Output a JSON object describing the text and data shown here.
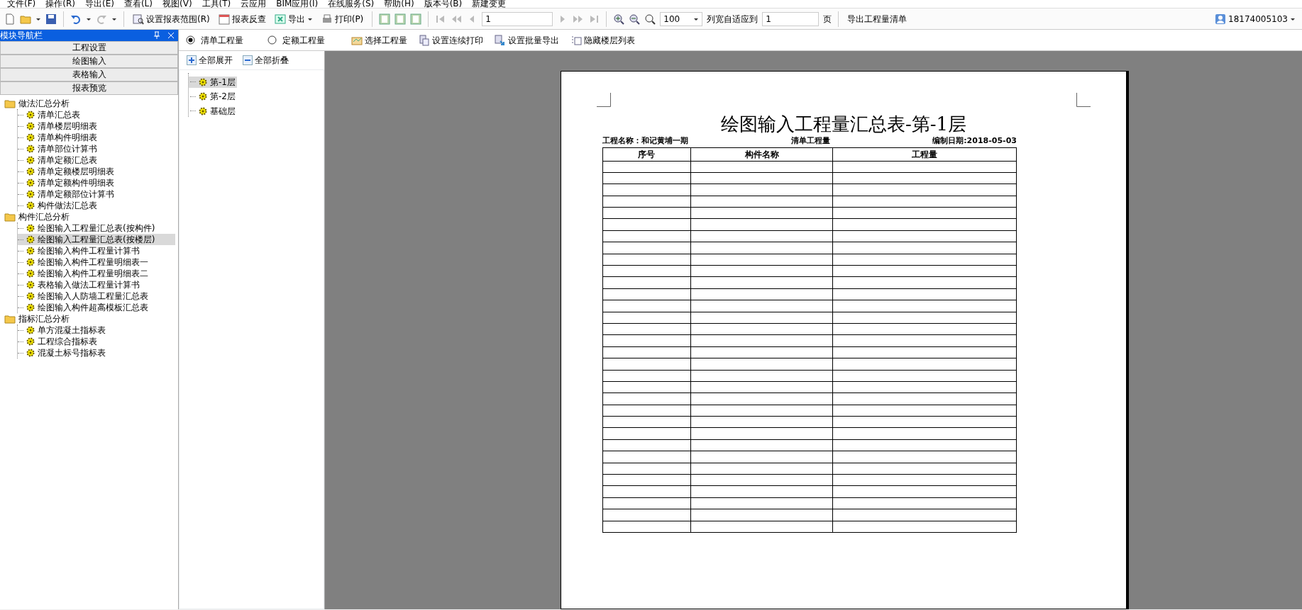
{
  "menu": [
    "文件(F)",
    "操作(R)",
    "导出(E)",
    "查看(L)",
    "视图(V)",
    "工具(T)",
    "云应用",
    "BIM应用(I)",
    "在线服务(S)",
    "帮助(H)",
    "版本号(B)",
    "新建变更"
  ],
  "toolbar": {
    "report_buttons": [
      "设置报表范围(R)",
      "报表反查",
      "导出",
      "打印(P)"
    ],
    "page_field": "1",
    "zoom_value": "100",
    "fit_label": "列宽自适应到",
    "fit_pages": "1",
    "fit_unit": "页",
    "export_list": "导出工程量清单"
  },
  "user": "18174005103",
  "nav": {
    "title": "模块导航栏",
    "sections": [
      "工程设置",
      "绘图输入",
      "表格输入",
      "报表预览"
    ],
    "tree": [
      {
        "label": "做法汇总分析",
        "children": [
          {
            "label": "清单汇总表",
            "selected": false
          },
          {
            "label": "清单楼层明细表",
            "selected": false
          },
          {
            "label": "清单构件明细表",
            "selected": false
          },
          {
            "label": "清单部位计算书",
            "selected": false
          },
          {
            "label": "清单定额汇总表",
            "selected": false
          },
          {
            "label": "清单定额楼层明细表",
            "selected": false
          },
          {
            "label": "清单定额构件明细表",
            "selected": false
          },
          {
            "label": "清单定额部位计算书",
            "selected": false
          },
          {
            "label": "构件做法汇总表",
            "selected": false
          }
        ]
      },
      {
        "label": "构件汇总分析",
        "children": [
          {
            "label": "绘图输入工程量汇总表(按构件)",
            "selected": false
          },
          {
            "label": "绘图输入工程量汇总表(按楼层)",
            "selected": true
          },
          {
            "label": "绘图输入构件工程量计算书",
            "selected": false
          },
          {
            "label": "绘图输入构件工程量明细表一",
            "selected": false
          },
          {
            "label": "绘图输入构件工程量明细表二",
            "selected": false
          },
          {
            "label": "表格输入做法工程量计算书",
            "selected": false
          },
          {
            "label": "绘图输入人防墙工程量汇总表",
            "selected": false
          },
          {
            "label": "绘图输入构件超高模板汇总表",
            "selected": false
          }
        ]
      },
      {
        "label": "指标汇总分析",
        "children": [
          {
            "label": "单方混凝土指标表",
            "selected": false
          },
          {
            "label": "工程综合指标表",
            "selected": false
          },
          {
            "label": "混凝土标号指标表",
            "selected": false
          }
        ]
      }
    ]
  },
  "modes": [
    {
      "label": "清单工程量",
      "selected": true
    },
    {
      "label": "定额工程量",
      "selected": false
    }
  ],
  "actions": [
    "选择工程量",
    "设置连续打印",
    "设置批量导出",
    "隐藏楼层列表"
  ],
  "expand_buttons": [
    "全部展开",
    "全部折叠"
  ],
  "floors": [
    {
      "label": "第-1层",
      "selected": true
    },
    {
      "label": "第-2层",
      "selected": false
    },
    {
      "label": "基础层",
      "selected": false
    }
  ],
  "report": {
    "title": "绘图输入工程量汇总表-第-1层",
    "project": "工程名称：和记黄埔一期",
    "type": "清单工程量",
    "date": "编制日期:2018-05-03",
    "columns": [
      "序号",
      "构件名称",
      "工程量"
    ]
  }
}
